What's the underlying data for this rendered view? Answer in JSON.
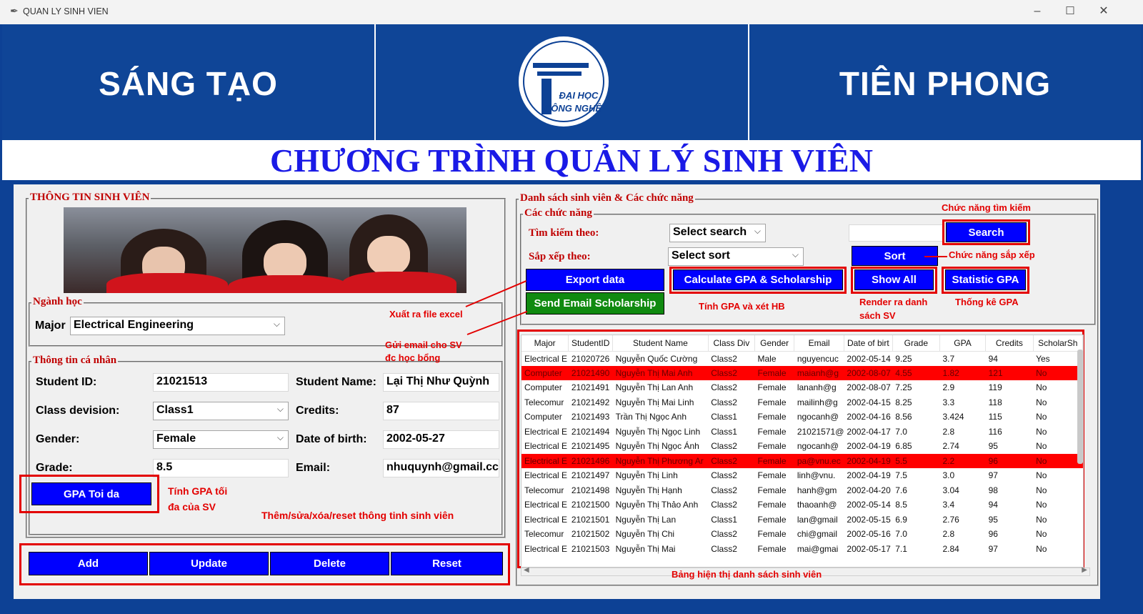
{
  "window": {
    "title": "QUAN LY SINH VIEN"
  },
  "banner": {
    "left": "SÁNG TẠO",
    "right": "TIÊN PHONG",
    "logo_line1": "ĐẠI HỌC",
    "logo_line2": "CÔNG NGHỆ"
  },
  "main_title": "CHƯƠNG TRÌNH QUẢN LÝ SINH VIÊN",
  "left_panel": {
    "legend": "THÔNG TIN SINH VIÊN",
    "major_legend": "Ngành học",
    "major_label": "Major",
    "major_value": "Electrical Engineering",
    "personal_legend": "Thông tin cá nhân",
    "student_id_label": "Student ID:",
    "student_id_value": "21021513",
    "student_name_label": "Student Name:",
    "student_name_value": "Lại Thị Như Quỳnh",
    "class_label": "Class devision:",
    "class_value": "Class1",
    "credits_label": "Credits:",
    "credits_value": "87",
    "gender_label": "Gender:",
    "gender_value": "Female",
    "dob_label": "Date of birth:",
    "dob_value": "2002-05-27",
    "grade_label": "Grade:",
    "grade_value": "8.5",
    "email_label": "Email:",
    "email_value": "nhuquynh@gmail.cc",
    "gpa_button": "GPA Toi da",
    "add_button": "Add",
    "update_button": "Update",
    "delete_button": "Delete",
    "reset_button": "Reset"
  },
  "right_panel": {
    "legend": "Danh sách sinh viên & Các chức năng",
    "functions_legend": "Các chức năng",
    "search_label": "Tìm kiếm theo:",
    "search_select": "Select search",
    "sort_label": "Sắp xếp theo:",
    "sort_select": "Select sort",
    "search_button": "Search",
    "sort_button": "Sort",
    "export_button": "Export data",
    "calc_button": "Calculate GPA & Scholarship",
    "show_all_button": "Show All",
    "statistic_button": "Statistic GPA",
    "email_button": "Send Email Scholarship"
  },
  "annotations": {
    "search": "Chức năng tìm kiếm",
    "sort": "Chức năng sắp xếp",
    "export_1": "Xuất ra file excel",
    "email_1": "Gửi email cho SV",
    "email_2": "đc học bổng",
    "calc": "Tính GPA và xét HB",
    "render_1": "Render ra danh",
    "render_2": "sách SV",
    "stat": "Thống kê GPA",
    "gpa_1": "Tính GPA tối",
    "gpa_2": "đa của SV",
    "crud": "Thêm/sửa/xóa/reset thông tinh sinh viên",
    "table": "Bảng hiện thị danh sách sinh viên"
  },
  "table": {
    "columns": [
      "Major",
      "StudentID",
      "Student Name",
      "Class Div",
      "Gender",
      "Email",
      "Date of birt",
      "Grade",
      "GPA",
      "Credits",
      "ScholarSh"
    ],
    "rows": [
      {
        "highlight": false,
        "cells": [
          "Electrical E",
          "21020726",
          "Nguyễn Quốc Cường",
          "Class2",
          "Male",
          "nguyencuc",
          "2002-05-14",
          "9.25",
          "3.7",
          "94",
          "Yes"
        ]
      },
      {
        "highlight": true,
        "cells": [
          "Computer",
          "21021490",
          "Nguyễn Thị Mai Anh",
          "Class2",
          "Female",
          "maianh@g",
          "2002-08-07",
          "4.55",
          "1.82",
          "121",
          "No"
        ]
      },
      {
        "highlight": false,
        "cells": [
          "Computer",
          "21021491",
          "Nguyễn Thị Lan Anh",
          "Class2",
          "Female",
          "lananh@g",
          "2002-08-07",
          "7.25",
          "2.9",
          "119",
          "No"
        ]
      },
      {
        "highlight": false,
        "cells": [
          "Telecomur",
          "21021492",
          "Nguyễn Thị Mai Linh",
          "Class2",
          "Female",
          "mailinh@g",
          "2002-04-15",
          "8.25",
          "3.3",
          "118",
          "No"
        ]
      },
      {
        "highlight": false,
        "cells": [
          "Computer",
          "21021493",
          "Trần Thị Ngọc Anh",
          "Class1",
          "Female",
          "ngocanh@",
          "2002-04-16",
          "8.56",
          "3.424",
          "115",
          "No"
        ]
      },
      {
        "highlight": false,
        "cells": [
          "Electrical E",
          "21021494",
          "Nguyễn Thị Ngọc Linh",
          "Class1",
          "Female",
          "21021571@",
          "2002-04-17",
          "7.0",
          "2.8",
          "116",
          "No"
        ]
      },
      {
        "highlight": false,
        "cells": [
          "Electrical E",
          "21021495",
          "Nguyễn Thị Ngọc Ánh",
          "Class2",
          "Female",
          "ngocanh@",
          "2002-04-19",
          "6.85",
          "2.74",
          "95",
          "No"
        ]
      },
      {
        "highlight": true,
        "cells": [
          "Electrical E",
          "21021496",
          "Nguyễn Thị Phương Ar",
          "Class2",
          "Female",
          "pa@vnu.ec",
          "2002-04-19",
          "5.5",
          "2.2",
          "96",
          "No"
        ]
      },
      {
        "highlight": false,
        "cells": [
          "Electrical E",
          "21021497",
          "Nguyễn Thị Linh",
          "Class2",
          "Female",
          "linh@vnu.",
          "2002-04-19",
          "7.5",
          "3.0",
          "97",
          "No"
        ]
      },
      {
        "highlight": false,
        "cells": [
          "Telecomur",
          "21021498",
          "Nguyễn Thị Hạnh",
          "Class2",
          "Female",
          "hanh@gm",
          "2002-04-20",
          "7.6",
          "3.04",
          "98",
          "No"
        ]
      },
      {
        "highlight": false,
        "cells": [
          "Electrical E",
          "21021500",
          "Nguyễn Thị Thảo Anh",
          "Class2",
          "Female",
          "thaoanh@",
          "2002-05-14",
          "8.5",
          "3.4",
          "94",
          "No"
        ]
      },
      {
        "highlight": false,
        "cells": [
          "Electrical E",
          "21021501",
          "Nguyễn Thị Lan",
          "Class1",
          "Female",
          "lan@gmail",
          "2002-05-15",
          "6.9",
          "2.76",
          "95",
          "No"
        ]
      },
      {
        "highlight": false,
        "cells": [
          "Telecomur",
          "21021502",
          "Nguyễn Thị Chi",
          "Class2",
          "Female",
          "chi@gmail",
          "2002-05-16",
          "7.0",
          "2.8",
          "96",
          "No"
        ]
      },
      {
        "highlight": false,
        "cells": [
          "Electrical E",
          "21021503",
          "Nguyễn Thị Mai",
          "Class2",
          "Female",
          "mai@gmai",
          "2002-05-17",
          "7.1",
          "2.84",
          "97",
          "No"
        ]
      }
    ]
  }
}
